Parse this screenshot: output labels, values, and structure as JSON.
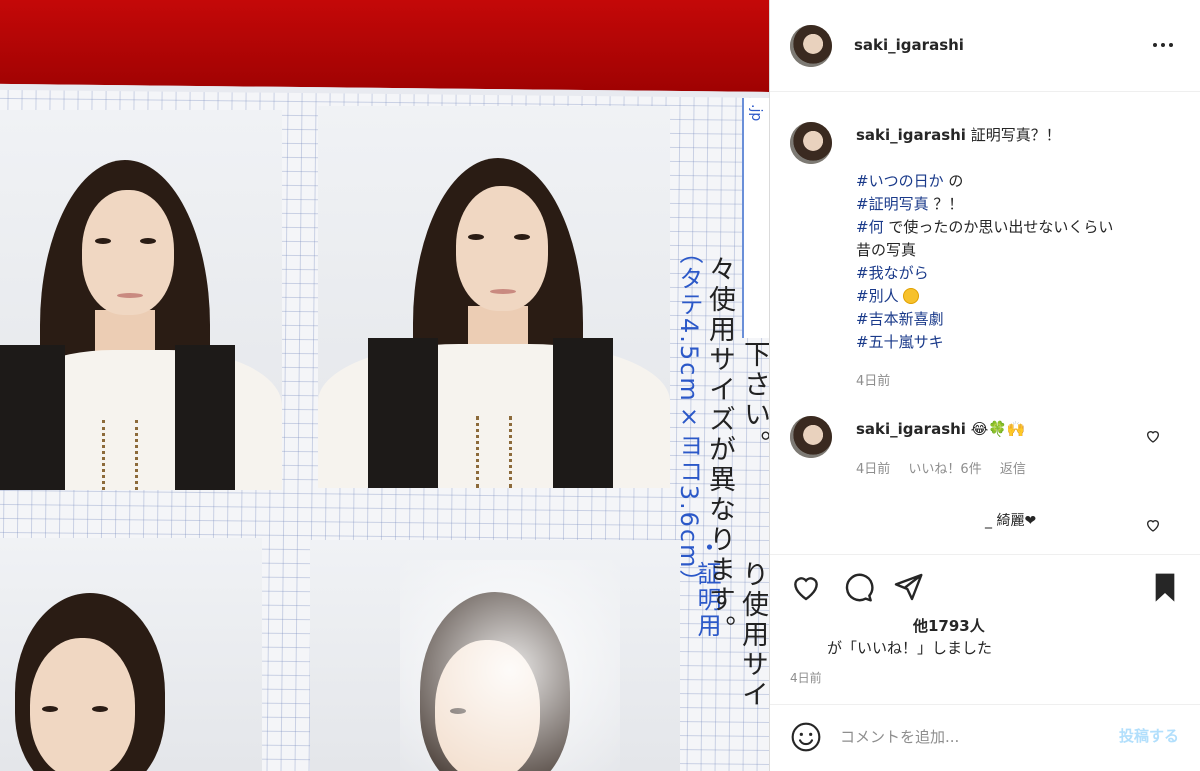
{
  "post": {
    "username": "saki_igarashi",
    "more_label": "...",
    "caption_text": "証明写真？！",
    "caption_lines": [
      {
        "tag": "#いつの日か",
        "rest": " の"
      },
      {
        "tag": "#証明写真",
        "rest": " ？！"
      },
      {
        "tag": "#何",
        "rest": " で使ったのか思い出せないくらい"
      },
      {
        "tag": "",
        "rest": "昔の写真"
      },
      {
        "tag": "#我ながら",
        "rest": ""
      },
      {
        "tag": "#別人",
        "rest": " "
      },
      {
        "tag": "#吉本新喜劇",
        "rest": ""
      },
      {
        "tag": "#五十嵐サキ",
        "rest": ""
      }
    ],
    "caption_time": "4日前"
  },
  "comments": [
    {
      "username": "saki_igarashi",
      "emojis": "😂🍀🙌",
      "time": "4日前",
      "likes": "いいね！6件",
      "reply": "返信"
    },
    {
      "username": "",
      "text": "_ 綺麗❤",
      "time": "",
      "likes": "",
      "reply": ""
    }
  ],
  "actions": {
    "likes_count": "他1793人",
    "likes_text": "が「いいね！」しました",
    "post_time": "4日前"
  },
  "comment_box": {
    "placeholder": "コメントを追加...",
    "post_label": "投稿する"
  },
  "photo_sheet": {
    "blue_text": "（タテ4.5cm×ヨコ3.6cm）",
    "blue_text_2": "・証明用",
    "black_text_1": "々使用サイズが異なります。",
    "black_text_2": "ご利用下さい。",
    "black_text_3": "り使用サイ",
    "tab_text": ".jp"
  },
  "colors": {
    "hashtag": "#1a3a8a",
    "post_button": "#b2dffc",
    "sheet_blue": "#2b58c8"
  }
}
